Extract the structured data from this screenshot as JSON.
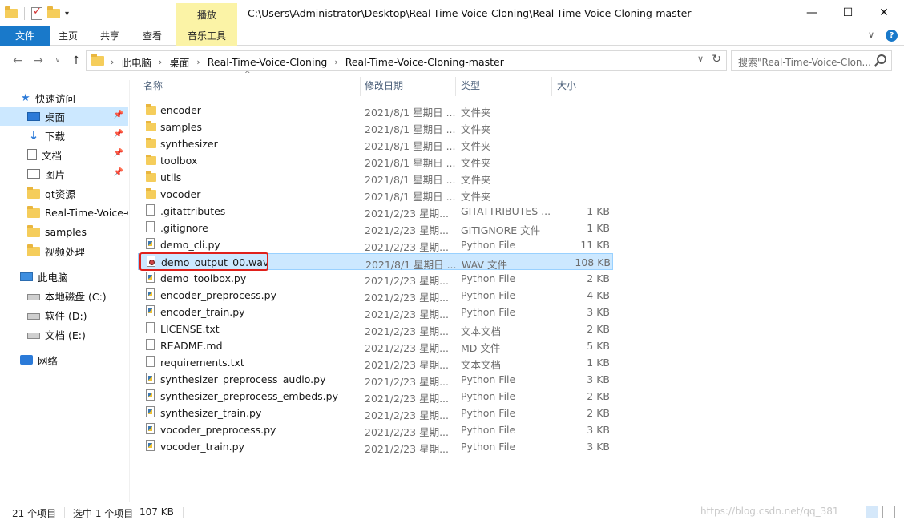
{
  "window": {
    "title": "C:\\Users\\Administrator\\Desktop\\Real-Time-Voice-Cloning\\Real-Time-Voice-Cloning-master",
    "context_tab_group": "播放",
    "minimize_icon": "minimize-icon",
    "maximize_icon": "maximize-icon",
    "close_icon": "close-icon"
  },
  "ribbon": {
    "tabs": [
      "文件",
      "主页",
      "共享",
      "查看",
      "音乐工具"
    ],
    "accent": "#1979ca",
    "context_color": "#fbf3a6"
  },
  "address": {
    "crumbs": [
      "此电脑",
      "桌面",
      "Real-Time-Voice-Cloning",
      "Real-Time-Voice-Cloning-master"
    ],
    "search_placeholder": "搜索\"Real-Time-Voice-Clon..."
  },
  "sidebar": {
    "quick_access": "快速访问",
    "items": [
      {
        "label": "桌面",
        "icon": "desktop-icon",
        "pinned": true,
        "selected": true
      },
      {
        "label": "下载",
        "icon": "download-icon",
        "pinned": true
      },
      {
        "label": "文档",
        "icon": "document-icon",
        "pinned": true
      },
      {
        "label": "图片",
        "icon": "pictures-icon",
        "pinned": true
      },
      {
        "label": "qt资源",
        "icon": "folder-icon"
      },
      {
        "label": "Real-Time-Voice-C",
        "icon": "folder-icon"
      },
      {
        "label": "samples",
        "icon": "folder-icon"
      },
      {
        "label": "视频处理",
        "icon": "folder-icon"
      }
    ],
    "this_pc": "此电脑",
    "drives": [
      {
        "label": "本地磁盘 (C:)",
        "icon": "windows-drive-icon"
      },
      {
        "label": "软件 (D:)",
        "icon": "drive-icon"
      },
      {
        "label": "文档 (E:)",
        "icon": "drive-icon"
      }
    ],
    "network": "网络"
  },
  "columns": {
    "name": "名称",
    "date": "修改日期",
    "type": "类型",
    "size": "大小"
  },
  "files": [
    {
      "name": "encoder",
      "date": "2021/8/1 星期日 ...",
      "type": "文件夹",
      "size": "",
      "icon": "folder"
    },
    {
      "name": "samples",
      "date": "2021/8/1 星期日 ...",
      "type": "文件夹",
      "size": "",
      "icon": "folder"
    },
    {
      "name": "synthesizer",
      "date": "2021/8/1 星期日 ...",
      "type": "文件夹",
      "size": "",
      "icon": "folder"
    },
    {
      "name": "toolbox",
      "date": "2021/8/1 星期日 ...",
      "type": "文件夹",
      "size": "",
      "icon": "folder"
    },
    {
      "name": "utils",
      "date": "2021/8/1 星期日 ...",
      "type": "文件夹",
      "size": "",
      "icon": "folder"
    },
    {
      "name": "vocoder",
      "date": "2021/8/1 星期日 ...",
      "type": "文件夹",
      "size": "",
      "icon": "folder"
    },
    {
      "name": ".gitattributes",
      "date": "2021/2/23 星期...",
      "type": "GITATTRIBUTES ...",
      "size": "1 KB",
      "icon": "doc"
    },
    {
      "name": ".gitignore",
      "date": "2021/2/23 星期...",
      "type": "GITIGNORE 文件",
      "size": "1 KB",
      "icon": "doc"
    },
    {
      "name": "demo_cli.py",
      "date": "2021/2/23 星期...",
      "type": "Python File",
      "size": "11 KB",
      "icon": "py"
    },
    {
      "name": "demo_output_00.wav",
      "date": "2021/8/1 星期日 ...",
      "type": "WAV 文件",
      "size": "108 KB",
      "icon": "wav",
      "selected": true
    },
    {
      "name": "demo_toolbox.py",
      "date": "2021/2/23 星期...",
      "type": "Python File",
      "size": "2 KB",
      "icon": "py"
    },
    {
      "name": "encoder_preprocess.py",
      "date": "2021/2/23 星期...",
      "type": "Python File",
      "size": "4 KB",
      "icon": "py"
    },
    {
      "name": "encoder_train.py",
      "date": "2021/2/23 星期...",
      "type": "Python File",
      "size": "3 KB",
      "icon": "py"
    },
    {
      "name": "LICENSE.txt",
      "date": "2021/2/23 星期...",
      "type": "文本文档",
      "size": "2 KB",
      "icon": "doc"
    },
    {
      "name": "README.md",
      "date": "2021/2/23 星期...",
      "type": "MD 文件",
      "size": "5 KB",
      "icon": "doc"
    },
    {
      "name": "requirements.txt",
      "date": "2021/2/23 星期...",
      "type": "文本文档",
      "size": "1 KB",
      "icon": "doc"
    },
    {
      "name": "synthesizer_preprocess_audio.py",
      "date": "2021/2/23 星期...",
      "type": "Python File",
      "size": "3 KB",
      "icon": "py"
    },
    {
      "name": "synthesizer_preprocess_embeds.py",
      "date": "2021/2/23 星期...",
      "type": "Python File",
      "size": "2 KB",
      "icon": "py"
    },
    {
      "name": "synthesizer_train.py",
      "date": "2021/2/23 星期...",
      "type": "Python File",
      "size": "2 KB",
      "icon": "py"
    },
    {
      "name": "vocoder_preprocess.py",
      "date": "2021/2/23 星期...",
      "type": "Python File",
      "size": "3 KB",
      "icon": "py"
    },
    {
      "name": "vocoder_train.py",
      "date": "2021/2/23 星期...",
      "type": "Python File",
      "size": "3 KB",
      "icon": "py"
    }
  ],
  "status": {
    "count": "21 个项目",
    "selection": "选中 1 个项目",
    "selection_size": "107 KB",
    "watermark": "https://blog.csdn.net/qq_381"
  },
  "colors": {
    "selection": "#cce8ff",
    "highlight_box": "#e0201b"
  }
}
